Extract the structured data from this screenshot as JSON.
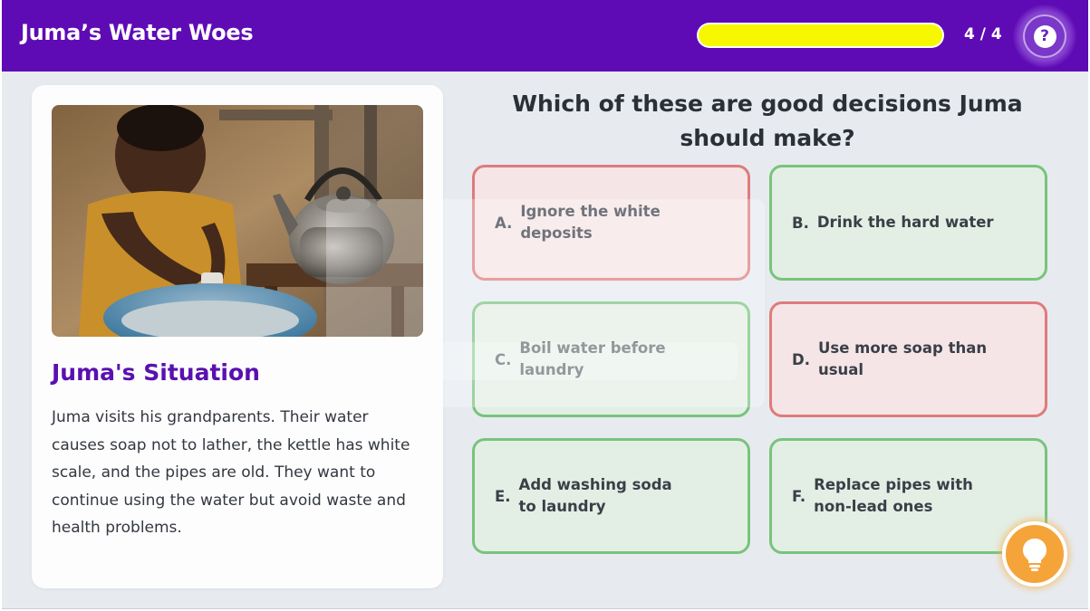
{
  "header": {
    "title": "Juma’s Water Woes",
    "progress_fraction": 1.0,
    "progress_text": "4 / 4",
    "help_icon": "question-mark-icon"
  },
  "colors": {
    "header_bg": "#5f0bb5",
    "progress_fill": "#f7f700",
    "accent_purple": "#5a10b0",
    "wrong_border": "#df7b7b",
    "wrong_bg": "#f5e5e6",
    "right_border": "#78c47c",
    "right_bg": "#e3efe5",
    "hint_orange": "#f5a43a"
  },
  "situation": {
    "image_alt_icon": "child-washing-with-kettle-photo",
    "title": "Juma's Situation",
    "text": "Juma visits his grandparents. Their water causes soap not to lather, the kettle has white scale, and the pipes are old. They want to continue using the water but avoid waste and health problems."
  },
  "question": "Which of these are good decisions Juma should make?",
  "options": [
    {
      "letter": "A.",
      "label": "Ignore the white deposits",
      "status": "incorrect"
    },
    {
      "letter": "B.",
      "label": "Drink the hard water",
      "status": "correct"
    },
    {
      "letter": "C.",
      "label": "Boil water before laundry",
      "status": "correct"
    },
    {
      "letter": "D.",
      "label": "Use more soap than usual",
      "status": "incorrect"
    },
    {
      "letter": "E.",
      "label": "Add washing soda to laundry",
      "status": "correct"
    },
    {
      "letter": "F.",
      "label": "Replace pipes with non-lead ones",
      "status": "correct"
    }
  ],
  "hint_icon": "lightbulb-icon"
}
